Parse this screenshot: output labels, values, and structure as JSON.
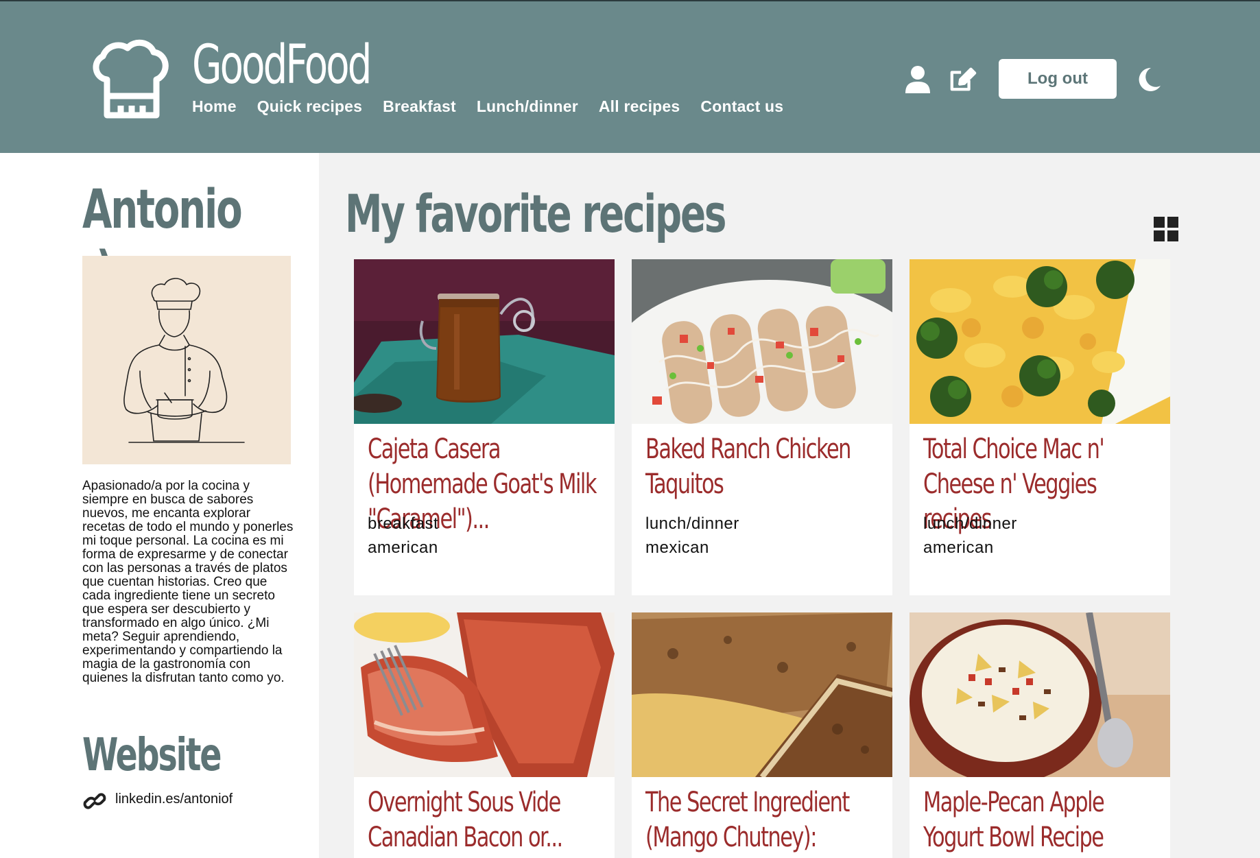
{
  "header": {
    "brand": "GoodFood",
    "nav": [
      "Home",
      "Quick recipes",
      "Breakfast",
      "Lunch/dinner",
      "All recipes",
      "Contact us"
    ],
    "logout_label": "Log out",
    "icons": [
      "chef-hat-icon",
      "user-icon",
      "edit-icon",
      "moon-icon"
    ],
    "bg_color": "#6a898b"
  },
  "sidebar": {
    "name": "Antonio :)",
    "bio": "Apasionado/a por la cocina y siempre en busca de sabores nuevos, me encanta explorar recetas de todo el mundo y ponerles mi toque personal. La cocina es mi forma de expresarme y de conectar con las personas a través de platos que cuentan historias. Creo que cada ingrediente tiene un secreto que espera ser descubierto y transformado en algo único. ¿Mi meta? Seguir aprendiendo, experimentando y compartiendo la magia de la gastronomía con quienes la disfrutan tanto como yo.",
    "website_title": "Website",
    "website_link": "linkedin.es/antoniof"
  },
  "main": {
    "title": "My favorite recipes",
    "recipes": [
      {
        "title": "Cajeta Casera (Homemade Goat's Milk \"Caramel\")...",
        "meal": "breakfast",
        "cuisine": "american"
      },
      {
        "title": "Baked Ranch Chicken Taquitos",
        "meal": "lunch/dinner",
        "cuisine": "mexican"
      },
      {
        "title": "Total Choice Mac n' Cheese n' Veggies recipes",
        "meal": "lunch/dinner",
        "cuisine": "american"
      },
      {
        "title": "Overnight Sous Vide Canadian Bacon or...",
        "meal": "",
        "cuisine": ""
      },
      {
        "title": "The Secret Ingredient (Mango Chutney): Chutne...",
        "meal": "",
        "cuisine": ""
      },
      {
        "title": "Maple-Pecan Apple Yogurt Bowl Recipe",
        "meal": "",
        "cuisine": ""
      }
    ]
  },
  "colors": {
    "accent_teal": "#5d7476",
    "recipe_title_red": "#9b2c2c",
    "main_bg": "#f2f2f2"
  }
}
